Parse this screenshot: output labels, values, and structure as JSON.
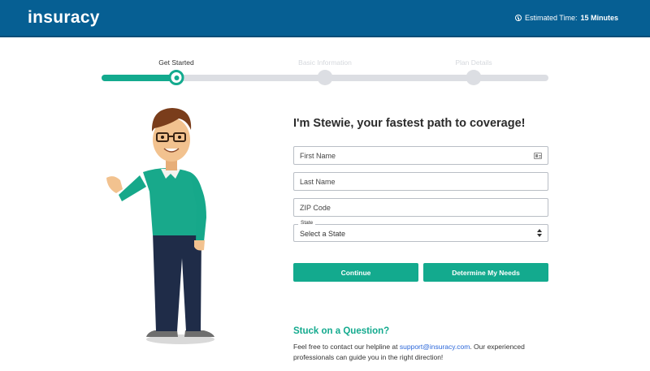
{
  "header": {
    "logo": "insuracy",
    "estimated_label": "Estimated Time:",
    "estimated_value": "15 Minutes"
  },
  "progress": {
    "steps": [
      {
        "label": "Get Started",
        "state": "current"
      },
      {
        "label": "Basic Information",
        "state": "upcoming"
      },
      {
        "label": "Plan Details",
        "state": "upcoming"
      }
    ],
    "completion": 0.17
  },
  "form": {
    "heading": "I'm Stewie, your fastest path to coverage!",
    "first_name_placeholder": "First Name",
    "last_name_placeholder": "Last Name",
    "zip_placeholder": "ZIP Code",
    "state_legend": "State",
    "state_value": "Select a State",
    "continue_label": "Continue",
    "determine_label": "Determine My Needs"
  },
  "help": {
    "title": "Stuck on a Question?",
    "text_before": "Feel free to contact our helpline at ",
    "email": "support@insuracy.com",
    "text_after": ". Our experienced professionals can guide you in the right direction!"
  },
  "colors": {
    "header_bg": "#065f93",
    "accent": "#13aa8e",
    "track": "#dcdee3",
    "link": "#2a66d9"
  },
  "icons": [
    "clock-icon",
    "contact-card-icon",
    "select-arrows-icon"
  ]
}
